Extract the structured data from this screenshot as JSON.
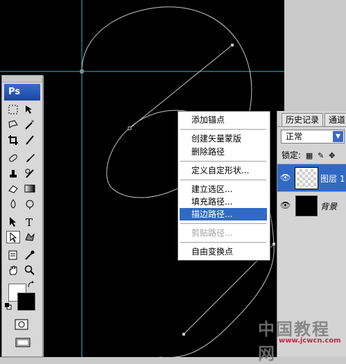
{
  "toolbox": {
    "logo": "Ps"
  },
  "context_menu": {
    "items": [
      {
        "label": "添加锚点",
        "state": "normal"
      },
      {
        "label": "创建矢量蒙版",
        "state": "normal"
      },
      {
        "label": "删除路径",
        "state": "normal"
      },
      {
        "label": "定义自定形状...",
        "state": "normal"
      },
      {
        "label": "建立选区...",
        "state": "normal"
      },
      {
        "label": "填充路径...",
        "state": "normal"
      },
      {
        "label": "描边路径...",
        "state": "highlighted"
      },
      {
        "label": "剪贴路径...",
        "state": "disabled"
      },
      {
        "label": "自由变换点",
        "state": "normal"
      }
    ]
  },
  "layers_panel": {
    "tabs": [
      "历史记录",
      "通道"
    ],
    "blend_mode": "正常",
    "lock_label": "锁定:",
    "layers": [
      {
        "name": "图层 1",
        "selected": true,
        "visible": true,
        "thumbnail": "transparent"
      },
      {
        "name": "背景",
        "selected": false,
        "visible": true,
        "thumbnail": "black"
      }
    ]
  },
  "watermark": {
    "text": "中国教程网",
    "url": "www.jcwcn.com"
  },
  "colors": {
    "menu_highlight": "#316ac5",
    "canvas": "#000000",
    "guide": "#36b6d6",
    "path": "#c8c8c8"
  }
}
